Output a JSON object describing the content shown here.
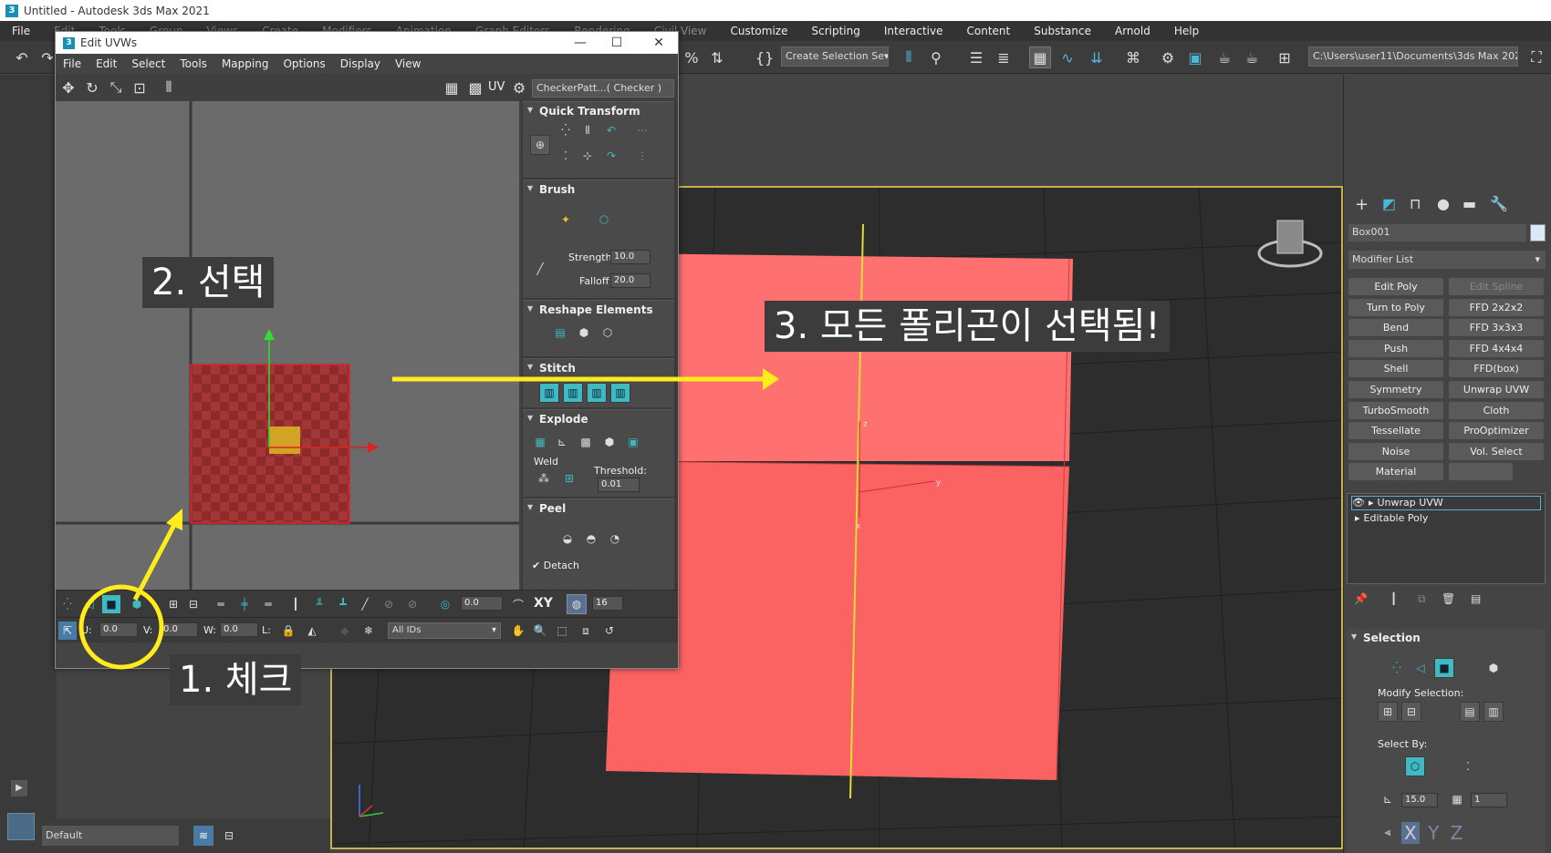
{
  "app": {
    "title": "Untitled - Autodesk 3ds Max 2021"
  },
  "menubar": {
    "items": [
      "File",
      "Edit",
      "Tools",
      "Group",
      "Views",
      "Create",
      "Modifiers",
      "Animation",
      "Graph Editors",
      "Rendering",
      "Civil View",
      "Customize",
      "Scripting",
      "Interactive",
      "Content",
      "Substance",
      "Arnold",
      "Help"
    ]
  },
  "toolbar": {
    "selection_set": "Create Selection Se▾",
    "project_path": "C:\\Users\\user11\\Documents\\3ds Max 2021 ▾"
  },
  "uv_window": {
    "title": "Edit UVWs",
    "menu": [
      "File",
      "Edit",
      "Select",
      "Tools",
      "Mapping",
      "Options",
      "Display",
      "View"
    ],
    "uv_label": "UV",
    "texture_dropdown": "CheckerPatt...( Checker )",
    "rollouts": {
      "quick_transform": "Quick Transform",
      "brush": "Brush",
      "strength_label": "Strength:",
      "strength_value": "10.0",
      "falloff_label": "Falloff:",
      "falloff_value": "20.0",
      "reshape": "Reshape Elements",
      "stitch": "Stitch",
      "explode": "Explode",
      "weld_label": "Weld",
      "threshold_label": "Threshold:",
      "threshold_value": "0.01",
      "peel": "Peel",
      "detach_label": "Detach"
    },
    "bottom": {
      "soft_value": "0.0",
      "xy_label": "XY",
      "count_value": "16",
      "u_value": "0.0",
      "v_label": "V:",
      "v_value": "0.0",
      "w_label": "W:",
      "w_value": "0.0",
      "l_label": "L:",
      "ids_dropdown": "All IDs"
    }
  },
  "command_panel": {
    "object_name": "Box001",
    "modifier_list": "Modifier List",
    "modifier_buttons": [
      [
        "Edit Poly",
        "Edit Spline"
      ],
      [
        "Turn to Poly",
        "FFD 2x2x2"
      ],
      [
        "Bend",
        "FFD 3x3x3"
      ],
      [
        "Push",
        "FFD 4x4x4"
      ],
      [
        "Shell",
        "FFD(box)"
      ],
      [
        "Symmetry",
        "Unwrap UVW"
      ],
      [
        "TurboSmooth",
        "Cloth"
      ],
      [
        "Tessellate",
        "ProOptimizer"
      ],
      [
        "Noise",
        "Vol. Select"
      ],
      [
        "Material",
        ""
      ]
    ],
    "stack": [
      "Unwrap UVW",
      "Editable Poly"
    ],
    "selection_rollout": "Selection",
    "modify_selection": "Modify Selection:",
    "select_by": "Select By:",
    "angle_value": "15.0",
    "count_value": "1",
    "axes": [
      "X",
      "Y",
      "Z"
    ]
  },
  "viewport_axes": {
    "z": "z",
    "y": "y",
    "x": "x"
  },
  "bottom": {
    "layer": "Default"
  },
  "annotations": {
    "step1": "1. 체크",
    "step2": "2. 선택",
    "step3": "3. 모든 폴리곤이 선택됨!"
  },
  "colors": {
    "accent_teal": "#3fb9c2",
    "annotation_yellow": "#ffec1a",
    "box_red": "#ff6b6b",
    "uv_selected": "#9b2f2f",
    "viewport_border": "#c8b14a"
  }
}
